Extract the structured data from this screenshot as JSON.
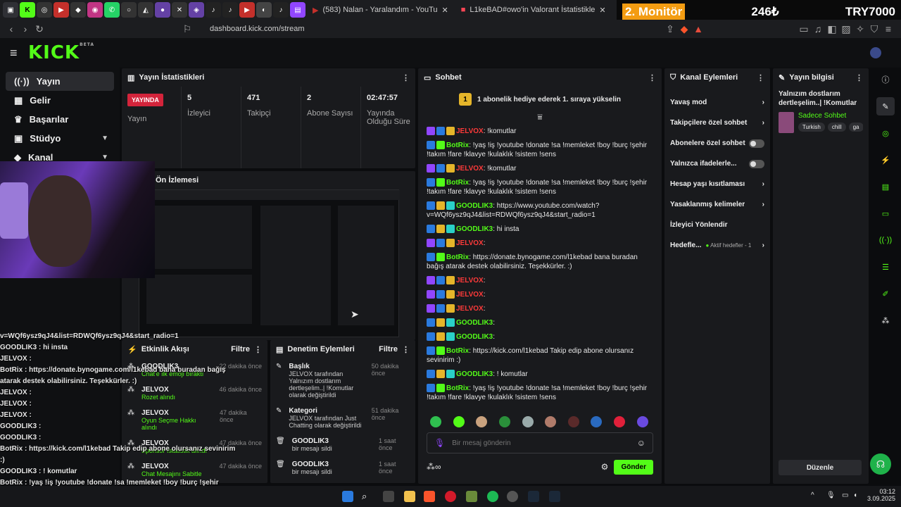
{
  "browser": {
    "tabs": [
      {
        "label": "(583) Nalan - Yaralandım - YouTu"
      },
      {
        "label": "L1keBAD#owo'in Valorant İstatistikle"
      }
    ],
    "url": "dashboard.kick.com/stream"
  },
  "overlay": {
    "monitor": "2. Monitör",
    "amount": "246₺",
    "code": "TRY7000"
  },
  "brand": {
    "logo": "KICK",
    "beta": "BETA"
  },
  "sidebar": {
    "items": [
      {
        "label": "Yayın"
      },
      {
        "label": "Gelir"
      },
      {
        "label": "Başarılar"
      },
      {
        "label": "Stüdyo"
      },
      {
        "label": "Kanal"
      }
    ]
  },
  "stats": {
    "title": "Yayın İstatistikleri",
    "live_badge": "YAYINDA",
    "live_label": "Yayın",
    "viewers_value": "5",
    "viewers_label": "İzleyici",
    "followers_value": "471",
    "followers_label": "Takipçi",
    "subs_value": "2",
    "subs_label": "Abone Sayısı",
    "uptime_value": "02:47:57",
    "uptime_label": "Yayında Olduğu Süre"
  },
  "preview": {
    "title": "Ön İzlemesi"
  },
  "activity": {
    "title": "Etkinlik Akışı",
    "filter": "Filtre",
    "rows": [
      {
        "user": "GOODLIK3",
        "time": "22 dakika önce",
        "desc": "Chat'e ilk emoji bıraktı"
      },
      {
        "user": "JELVOX",
        "time": "46 dakika önce",
        "desc": "Rozet alındı"
      },
      {
        "user": "JELVOX",
        "time": "47 dakika önce",
        "desc": "Oyun Seçme Hakkı alındı"
      },
      {
        "user": "JELVOX",
        "time": "47 dakika önce",
        "desc": "Sponsor İstatistik alındı"
      },
      {
        "user": "JELVOX",
        "time": "47 dakika önce",
        "desc": "Chat Mesajını Sabitle"
      }
    ]
  },
  "moderation": {
    "title": "Denetim Eylemleri",
    "filter": "Filtre",
    "rows": [
      {
        "title": "Başlık",
        "time": "50 dakika önce",
        "line": "JELVOX tarafından Yalnızım dostlarım dertleşelim..| !Komutlar olarak değiştirildi"
      },
      {
        "title": "Kategori",
        "time": "51 dakika önce",
        "line": "JELVOX tarafından Just Chatting olarak değiştirildi"
      },
      {
        "title": "GOODLIK3",
        "time": "1 saat önce",
        "line": "bir mesajı sildi"
      },
      {
        "title": "GOODLIK3",
        "time": "1 saat önce",
        "line": "bir mesajı sildi"
      }
    ]
  },
  "chat": {
    "title": "Sohbet",
    "banner_num": "1",
    "banner_text": "1 abonelik hediye ederek 1. sıraya yükselin",
    "messages": [
      {
        "user": "JELVOX",
        "text": ": !komutlar"
      },
      {
        "user": "BotRix",
        "text": ": !yaş !iş !youtube !donate !sa !memleket !boy !burç !şehir !takım !fare !klavye !kulaklık !sistem !sens"
      },
      {
        "user": "JELVOX",
        "text": ": !komutlar"
      },
      {
        "user": "BotRix",
        "text": ": !yaş !iş !youtube !donate !sa !memleket !boy !burç !şehir !takım !fare !klavye !kulaklık !sistem !sens"
      },
      {
        "user": "GOODLIK3",
        "text": ": https://www.youtube.com/watch?v=WQf6ysz9qJ4&list=RDWQf6ysz9qJ4&start_radio=1"
      },
      {
        "user": "GOODLIK3",
        "text": ": hi insta"
      },
      {
        "user": "JELVOX",
        "text": ":"
      },
      {
        "user": "BotRix",
        "text": ": https://donate.bynogame.com/l1kebad bana buradan bağış atarak destek olabilirsiniz. Teşekkürler. :)"
      },
      {
        "user": "JELVOX",
        "text": ":"
      },
      {
        "user": "JELVOX",
        "text": ":"
      },
      {
        "user": "JELVOX",
        "text": ":"
      },
      {
        "user": "GOODLIK3",
        "text": ":"
      },
      {
        "user": "GOODLIK3",
        "text": ":"
      },
      {
        "user": "BotRix",
        "text": ": https://kick.com/l1kebad Takip edip abone olursanız sevinirim :)"
      },
      {
        "user": "GOODLIK3",
        "text": ": ! komutlar"
      },
      {
        "user": "BotRix",
        "text": ": !yaş !iş !youtube !donate !sa !memleket !boy !burç !şehir !takım !fare !klavye !kulaklık !sistem !sens"
      }
    ],
    "input_placeholder": "Bir mesaj gönderin",
    "send_label": "Gönder"
  },
  "channel_actions": {
    "title": "Kanal Eylemleri",
    "items": [
      {
        "label": "Yavaş mod"
      },
      {
        "label": "Takipçilere özel sohbet"
      },
      {
        "label": "Abonelere özel sohbet"
      },
      {
        "label": "Yalnızca ifadelerle..."
      },
      {
        "label": "Hesap yaşı kısıtlaması"
      },
      {
        "label": "Yasaklanmış kelimeler"
      },
      {
        "label": "İzleyici Yönlendir"
      },
      {
        "label": "Hedefle..."
      }
    ],
    "goals_sub": "Aktif hedefler - 1"
  },
  "stream_info": {
    "title": "Yayın bilgisi",
    "stream_title": "Yalnızım dostlarım dertleşelim..| !Komutlar",
    "category": "Sadece Sohbet",
    "tags": [
      "Turkish",
      "chill",
      "ga"
    ],
    "edit_label": "Düzenle"
  },
  "overlay_chat": {
    "lines": [
      "v=WQf6ysz9qJ4&list=RDWQf6ysz9qJ4&start_radio=1",
      "GOODLIK3 : hi insta",
      "JELVOX :",
      "BotRix : https://donate.bynogame.com/l1kebad bana buradan bağış atarak destek olabilirsiniz. Teşekkürler. :)",
      "JELVOX :",
      "JELVOX :",
      "JELVOX :",
      "GOODLIK3 :",
      "GOODLIK3 :",
      "BotRix : https://kick.com/l1kebad Takip edip abone olursanız sevinirim :)",
      "GOODLIK3 : ! komutlar",
      "BotRix : !yaş !iş !youtube !donate !sa !memleket !boy !burç !şehir !takım !fare !klavye !kulaklık !sistem !sens"
    ]
  },
  "clock": {
    "time": "03:12",
    "date": "3.09.2025"
  },
  "colors": {
    "accent": "#53fc18",
    "live": "#d3243b",
    "user_red": "#ff3a3a"
  }
}
